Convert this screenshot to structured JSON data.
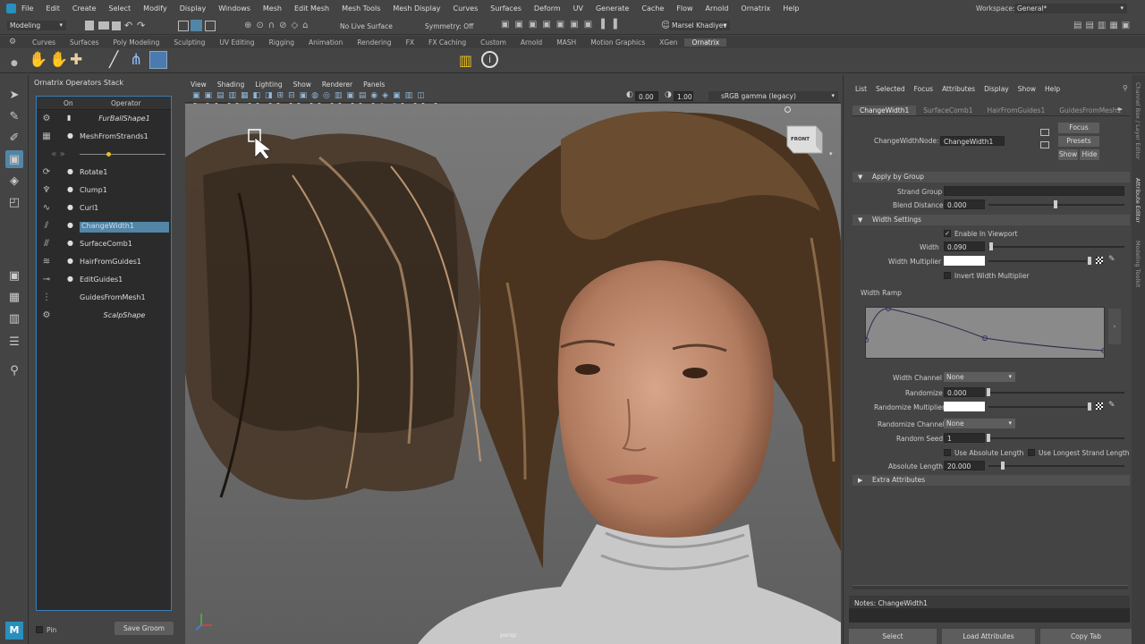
{
  "menubar": {
    "items": [
      "File",
      "Edit",
      "Create",
      "Select",
      "Modify",
      "Display",
      "Windows",
      "Mesh",
      "Edit Mesh",
      "Mesh Tools",
      "Mesh Display",
      "Curves",
      "Surfaces",
      "Deform",
      "UV",
      "Generate",
      "Cache",
      "Flow",
      "Arnold",
      "Ornatrix",
      "Help"
    ],
    "workspace_label": "Workspace:",
    "workspace_value": "General*"
  },
  "statusline": {
    "mode": "Modeling",
    "live_surface": "No Live Surface",
    "symmetry": "Symmetry: Off",
    "user": "Marsel Khadiyev"
  },
  "shelf_tabs": [
    "Curves",
    "Surfaces",
    "Poly Modeling",
    "Sculpting",
    "UV Editing",
    "Rigging",
    "Animation",
    "Rendering",
    "FX",
    "FX Caching",
    "Custom",
    "Arnold",
    "MASH",
    "Motion Graphics",
    "XGen",
    "Ornatrix"
  ],
  "shelf_active": "Ornatrix",
  "ops_stack": {
    "title": "Ornatrix Operators Stack",
    "col_on": "On",
    "col_operator": "Operator",
    "rows": [
      {
        "label": "FurBallShape1",
        "italic": true,
        "icon": "gear-icon"
      },
      {
        "label": "MeshFromStrands1",
        "italic": false,
        "icon": "strands-icon"
      },
      {
        "label": "",
        "italic": false,
        "icon": "arrows-icon"
      },
      {
        "label": "Rotate1",
        "italic": false,
        "icon": "rotate-icon"
      },
      {
        "label": "Clump1",
        "italic": false,
        "icon": "clump-icon"
      },
      {
        "label": "Curl1",
        "italic": false,
        "icon": "curl-icon"
      },
      {
        "label": "ChangeWidth1",
        "italic": false,
        "icon": "width-icon",
        "selected": true
      },
      {
        "label": "SurfaceComb1",
        "italic": false,
        "icon": "comb-icon"
      },
      {
        "label": "HairFromGuides1",
        "italic": false,
        "icon": "hair-icon"
      },
      {
        "label": "EditGuides1",
        "italic": false,
        "icon": "edit-guides-icon"
      },
      {
        "label": "GuidesFromMesh1",
        "italic": false,
        "icon": "guides-icon"
      },
      {
        "label": "ScalpShape",
        "italic": true,
        "icon": "gear-icon"
      }
    ],
    "pin_label": "Pin",
    "save_label": "Save Groom"
  },
  "viewport": {
    "menu": [
      "View",
      "Shading",
      "Lighting",
      "Show",
      "Renderer",
      "Panels"
    ],
    "field1": "0.00",
    "field2": "1.00",
    "colorspace": "sRGB gamma (legacy)",
    "camera_label": "persp",
    "viewcube_label": "FRONT"
  },
  "attr_editor": {
    "menu": [
      "List",
      "Selected",
      "Focus",
      "Attributes",
      "Display",
      "Show",
      "Help"
    ],
    "tabs": [
      "ChangeWidth1",
      "SurfaceComb1",
      "HairFromGuides1",
      "GuidesFromMesh1"
    ],
    "node_label": "ChangeWidthNode:",
    "node_value": "ChangeWidth1",
    "focus_btn": "Focus",
    "presets_btn": "Presets",
    "show_btn": "Show",
    "hide_btn": "Hide",
    "apply_by_group": "Apply by Group",
    "strand_group_label": "Strand Group",
    "blend_distance_label": "Blend Distance",
    "blend_distance_value": "0.000",
    "width_settings": "Width Settings",
    "enable_viewport_label": "Enable In Viewport",
    "width_label": "Width",
    "width_value": "0.090",
    "width_multiplier_label": "Width Multiplier",
    "invert_label": "Invert Width Multiplier",
    "width_ramp_label": "Width Ramp",
    "width_channel_label": "Width Channel",
    "width_channel_value": "None",
    "randomize_label": "Randomize",
    "randomize_value": "0.000",
    "randomize_mult_label": "Randomize Multiplier",
    "randomize_channel_label": "Randomize Channel",
    "randomize_channel_value": "None",
    "random_seed_label": "Random Seed",
    "random_seed_value": "1",
    "use_abs_label": "Use Absolute Length",
    "use_longest_label": "Use Longest Strand Length",
    "abs_length_label": "Absolute Length",
    "abs_length_value": "20.000",
    "extra_attrs": "Extra Attributes",
    "notes_label": "Notes:  ChangeWidth1",
    "select_btn": "Select",
    "load_btn": "Load Attributes",
    "copy_btn": "Copy Tab"
  },
  "side_tabs": [
    "Channel Box / Layer Editor",
    "Attribute Editor",
    "Modeling Toolkit"
  ],
  "colors": {
    "accent": "#5285a6",
    "panel": "#444444",
    "field": "#2b2b2b"
  }
}
